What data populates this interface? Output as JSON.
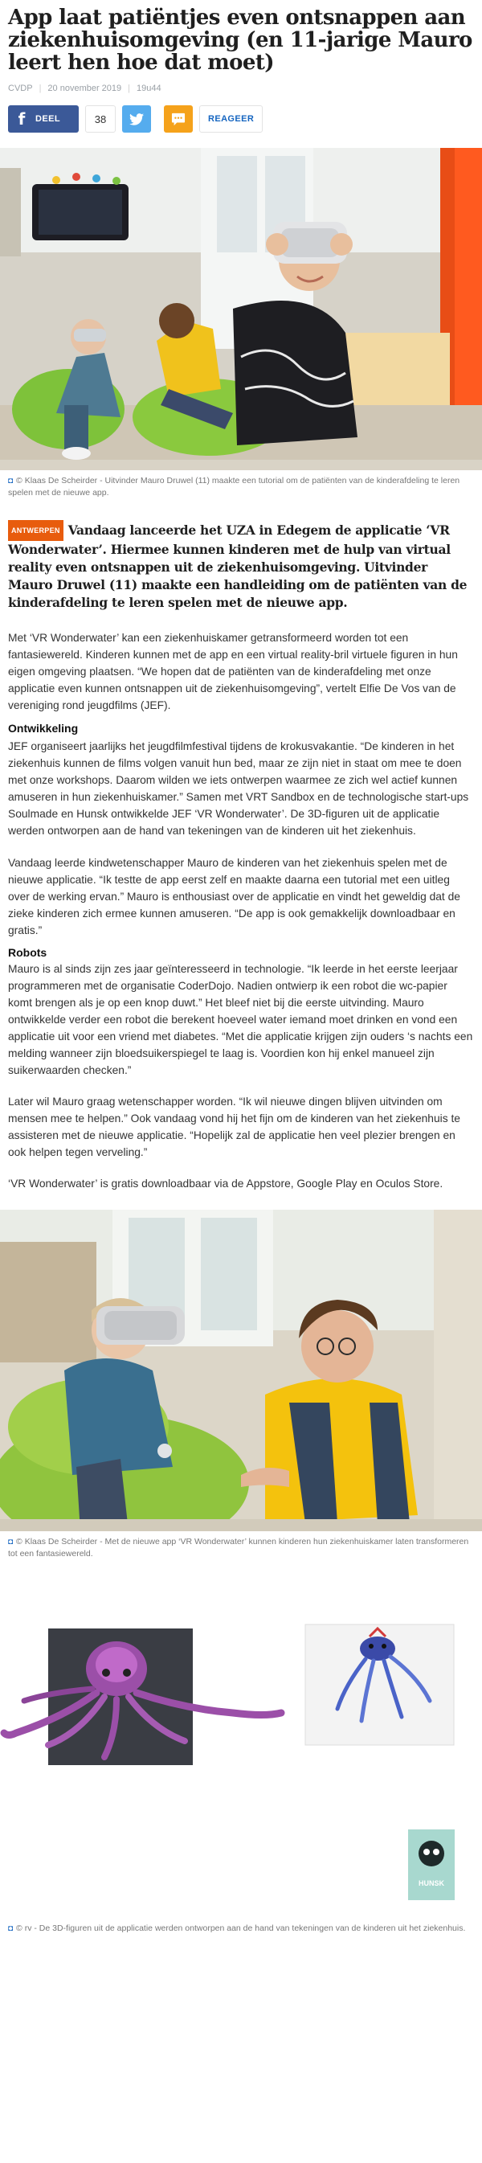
{
  "article": {
    "title": "App laat patiëntjes even ontsnappen aan ziekenhuisomgeving (en 11-jarige Mauro leert hen hoe dat moet)",
    "source": "CVDP",
    "date": "20 november 2019",
    "time": "19u44"
  },
  "share": {
    "facebook_label": "DEEL",
    "share_count": "38",
    "react_label": "REAGEER"
  },
  "photo1": {
    "caption": "© Klaas De Scheirder - Uitvinder Mauro Druwel (11) maakte een tutorial om de patiënten van de kinderafdeling te leren spelen met de nieuwe app."
  },
  "lead": {
    "tag": "ANTWERPEN",
    "text": "Vandaag lanceerde het UZA in Edegem de applicatie ‘VR Wonderwater’. Hiermee kunnen kinderen met de hulp van virtual reality even ontsnappen uit de ziekenhuisomgeving. Uitvinder Mauro Druwel (11) maakte een handleiding om de patiënten van de kinderafdeling te leren spelen met de nieuwe app."
  },
  "body": {
    "p1": "Met ‘VR Wonderwater’ kan een ziekenhuiskamer getransformeerd worden tot een fantasiewereld. Kinderen kunnen met de app en een virtual reality-bril virtuele figuren in hun eigen omgeving plaatsen. “We hopen dat de patiënten van de kinderafdeling met onze applicatie even kunnen ontsnappen uit de ziekenhuisomgeving”, vertelt Elfie De Vos van de vereniging rond jeugdfilms (JEF).",
    "h1": "Ontwikkeling",
    "p2": "JEF organiseert jaarlijks het jeugdfilmfestival tijdens de krokusvakantie. “De kinderen in het ziekenhuis kunnen de films volgen vanuit hun bed, maar ze zijn niet in staat om mee te doen met onze workshops. Daarom wilden we iets ontwerpen waarmee ze zich wel actief kunnen amuseren in hun ziekenhuiskamer.” Samen met VRT Sandbox en de technologische start-ups Soulmade en Hunsk ontwikkelde JEF ‘VR Wonderwater’. De 3D-figuren uit de applicatie werden ontworpen aan de hand van tekeningen van de kinderen uit het ziekenhuis.",
    "p3": "Vandaag leerde kindwetenschapper Mauro de kinderen van het ziekenhuis spelen met de nieuwe applicatie. “Ik testte de app eerst zelf en maakte daarna een tutorial met een uitleg over de werking ervan.” Mauro is enthousiast over de applicatie en vindt het geweldig dat de zieke kinderen zich ermee kunnen amuseren. “De app is ook gemakkelijk downloadbaar en gratis.”",
    "h2": "Robots",
    "p4": "Mauro is al sinds zijn zes jaar geïnteresseerd in technologie. “Ik leerde in het eerste leerjaar programmeren met de organisatie CoderDojo. Nadien ontwierp ik een robot die wc-papier komt brengen als je op een knop duwt.” Het bleef niet bij die eerste uitvinding. Mauro ontwikkelde verder een robot die berekent hoeveel water iemand moet drinken en vond een applicatie uit voor een vriend met diabetes. “Met die applicatie krijgen zijn ouders ‘s nachts een melding wanneer zijn bloedsuikerspiegel te laag is. Voordien kon hij enkel manueel zijn suikerwaarden checken.”",
    "p5": "Later wil Mauro graag wetenschapper worden. “Ik wil nieuwe dingen blijven uitvinden om mensen mee te helpen.” Ook vandaag vond hij het fijn om de kinderen van het ziekenhuis te assisteren met de nieuwe applicatie. “Hopelijk zal de applicatie hen veel plezier brengen en ook helpen tegen verveling.”",
    "p6": "‘VR Wonderwater’ is gratis downloadbaar via de Appstore, Google Play en Oculos Store."
  },
  "photo2": {
    "caption": "© Klaas De Scheirder - Met de nieuwe app ‘VR Wonderwater’ kunnen kinderen hun ziekenhuiskamer laten transformeren tot een fantasiewereld."
  },
  "photo3": {
    "logo_text": "HUNSK",
    "caption": "© rv - De 3D-figuren uit de applicatie werden ontworpen aan de hand van tekeningen van de kinderen uit het ziekenhuis."
  },
  "colors": {
    "facebook": "#3b5998",
    "twitter": "#55acee",
    "comment": "#f5a21b",
    "tag": "#e85c0d",
    "link": "#1565c0"
  }
}
